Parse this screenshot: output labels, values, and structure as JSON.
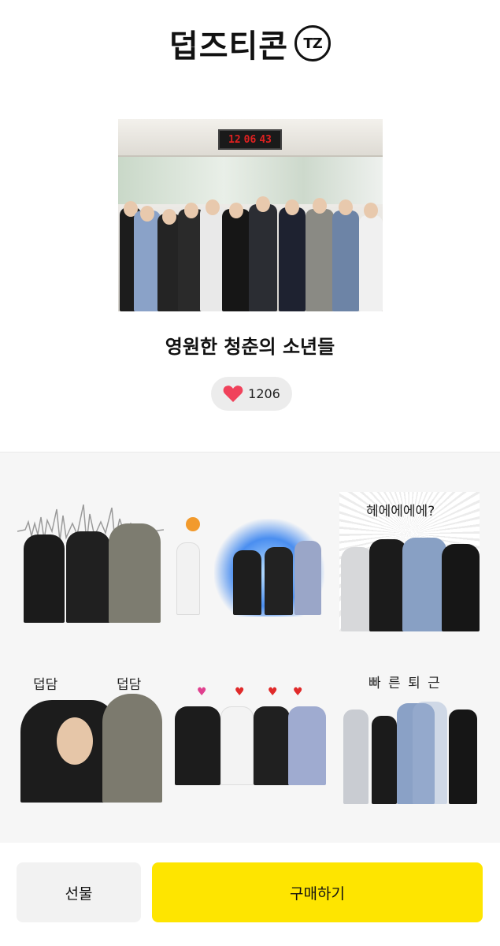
{
  "header": {
    "logo_text": "덥즈티콘",
    "logo_badge": "TZ"
  },
  "hero": {
    "clock": [
      "12",
      "06",
      "43"
    ]
  },
  "emoticon": {
    "title": "영원한 청춘의 소년들",
    "like_count": "1206",
    "accent_color": "#f0425b"
  },
  "stickers": {
    "captions": {
      "s3": "헤에에에에?",
      "s4_left": "덥담",
      "s4_right": "덥담",
      "s6": "빠 른 퇴 근"
    }
  },
  "actions": {
    "gift_label": "선물",
    "buy_label": "구매하기",
    "buy_color": "#fee500"
  }
}
